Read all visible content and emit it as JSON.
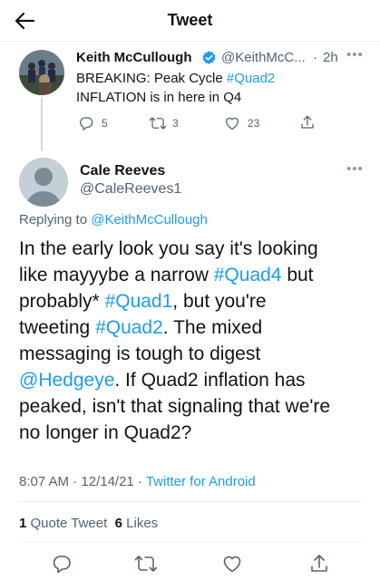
{
  "header": {
    "title": "Tweet"
  },
  "parent_tweet": {
    "author_name": "Keith McCullough",
    "author_handle": "@KeithMcC...",
    "separator": "·",
    "time": "2h",
    "line1_prefix": "BREAKING: Peak Cycle ",
    "line1_hashtag": "#Quad2",
    "line2": "INFLATION is in here in Q4",
    "replies": "5",
    "retweets": "3",
    "likes": "23"
  },
  "reply_tweet": {
    "author_name": "Cale Reeves",
    "author_handle": "@CaleReeves1",
    "replying_prefix": "Replying to ",
    "replying_handle": "@KeithMcCullough",
    "body": {
      "l1": "In the early look you say it's looking",
      "l2a": "like mayyybe a narrow ",
      "l2b": "#Quad4",
      "l2c": " but",
      "l3a": "probably* ",
      "l3b": "#Quad1",
      "l3c": ", but you're",
      "l4a": "tweeting ",
      "l4b": "#Quad2",
      "l4c": ".  The mixed",
      "l5": "messaging is tough to digest",
      "l6a": "@Hedgeye",
      "l6b": ".  If Quad2 inflation has",
      "l7": "peaked, isn't that signaling that we're",
      "l8": "no longer in Quad2?"
    },
    "time": "8:07 AM",
    "separator1": " · ",
    "date": "12/14/21",
    "separator2": " · ",
    "source": "Twitter for Android",
    "quote_count": "1",
    "quote_label": " Quote Tweet",
    "like_count": "6",
    "like_label": " Likes"
  },
  "colors": {
    "accent": "#1d9bf0",
    "secondary_text": "#536471",
    "primary_text": "#0f1419",
    "verified": "#1d9bf0"
  }
}
